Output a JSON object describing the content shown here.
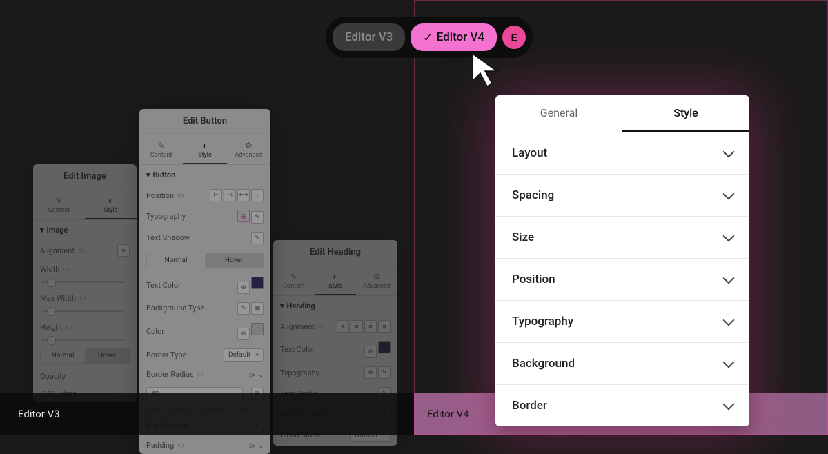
{
  "footer": {
    "left_label": "Editor V3",
    "right_label": "Editor V4"
  },
  "toggle": {
    "option_a": "Editor V3",
    "option_b": "Editor V4",
    "badge": "E"
  },
  "v3": {
    "image_panel": {
      "title": "Edit Image",
      "tabs": {
        "content": "Content",
        "style": "Style"
      },
      "section": "Image",
      "rows": {
        "alignment": "Alignment",
        "width": "Width",
        "max_width": "Max Width",
        "height": "Height",
        "opacity": "Opacity",
        "css_filters": "CSS Filters"
      },
      "states": {
        "normal": "Normal",
        "hover": "Hover"
      }
    },
    "button_panel": {
      "title": "Edit Button",
      "tabs": {
        "content": "Content",
        "style": "Style",
        "advanced": "Advanced"
      },
      "section": "Button",
      "rows": {
        "position": "Position",
        "typography": "Typography",
        "text_shadow": "Text Shadow",
        "text_color": "Text Color",
        "bg_type": "Background Type",
        "color": "Color",
        "border_type": "Border Type",
        "border_radius": "Border Radius",
        "box_shadow": "Box Shadow",
        "padding": "Padding"
      },
      "states": {
        "normal": "Normal",
        "hover": "Hover"
      },
      "border_select": "Default",
      "radius_value": "40",
      "unit_px": "px",
      "sides": {
        "top": "Top",
        "right": "Right",
        "bottom": "Bottom",
        "left": "Left"
      }
    },
    "heading_panel": {
      "title": "Edit Heading",
      "tabs": {
        "content": "Content",
        "style": "Style",
        "advanced": "Advanced"
      },
      "section": "Heading",
      "rows": {
        "alignment": "Alignment",
        "text_color": "Text Color",
        "typography": "Typography",
        "text_stroke": "Text Stroke",
        "text_shadow": "Text Shadow",
        "blend_mode": "Blend Mode"
      },
      "blend_value": "Normal"
    }
  },
  "v4": {
    "tabs": {
      "general": "General",
      "style": "Style"
    },
    "sections": {
      "layout": "Layout",
      "spacing": "Spacing",
      "size": "Size",
      "position": "Position",
      "typography": "Typography",
      "background": "Background",
      "border": "Border"
    }
  }
}
